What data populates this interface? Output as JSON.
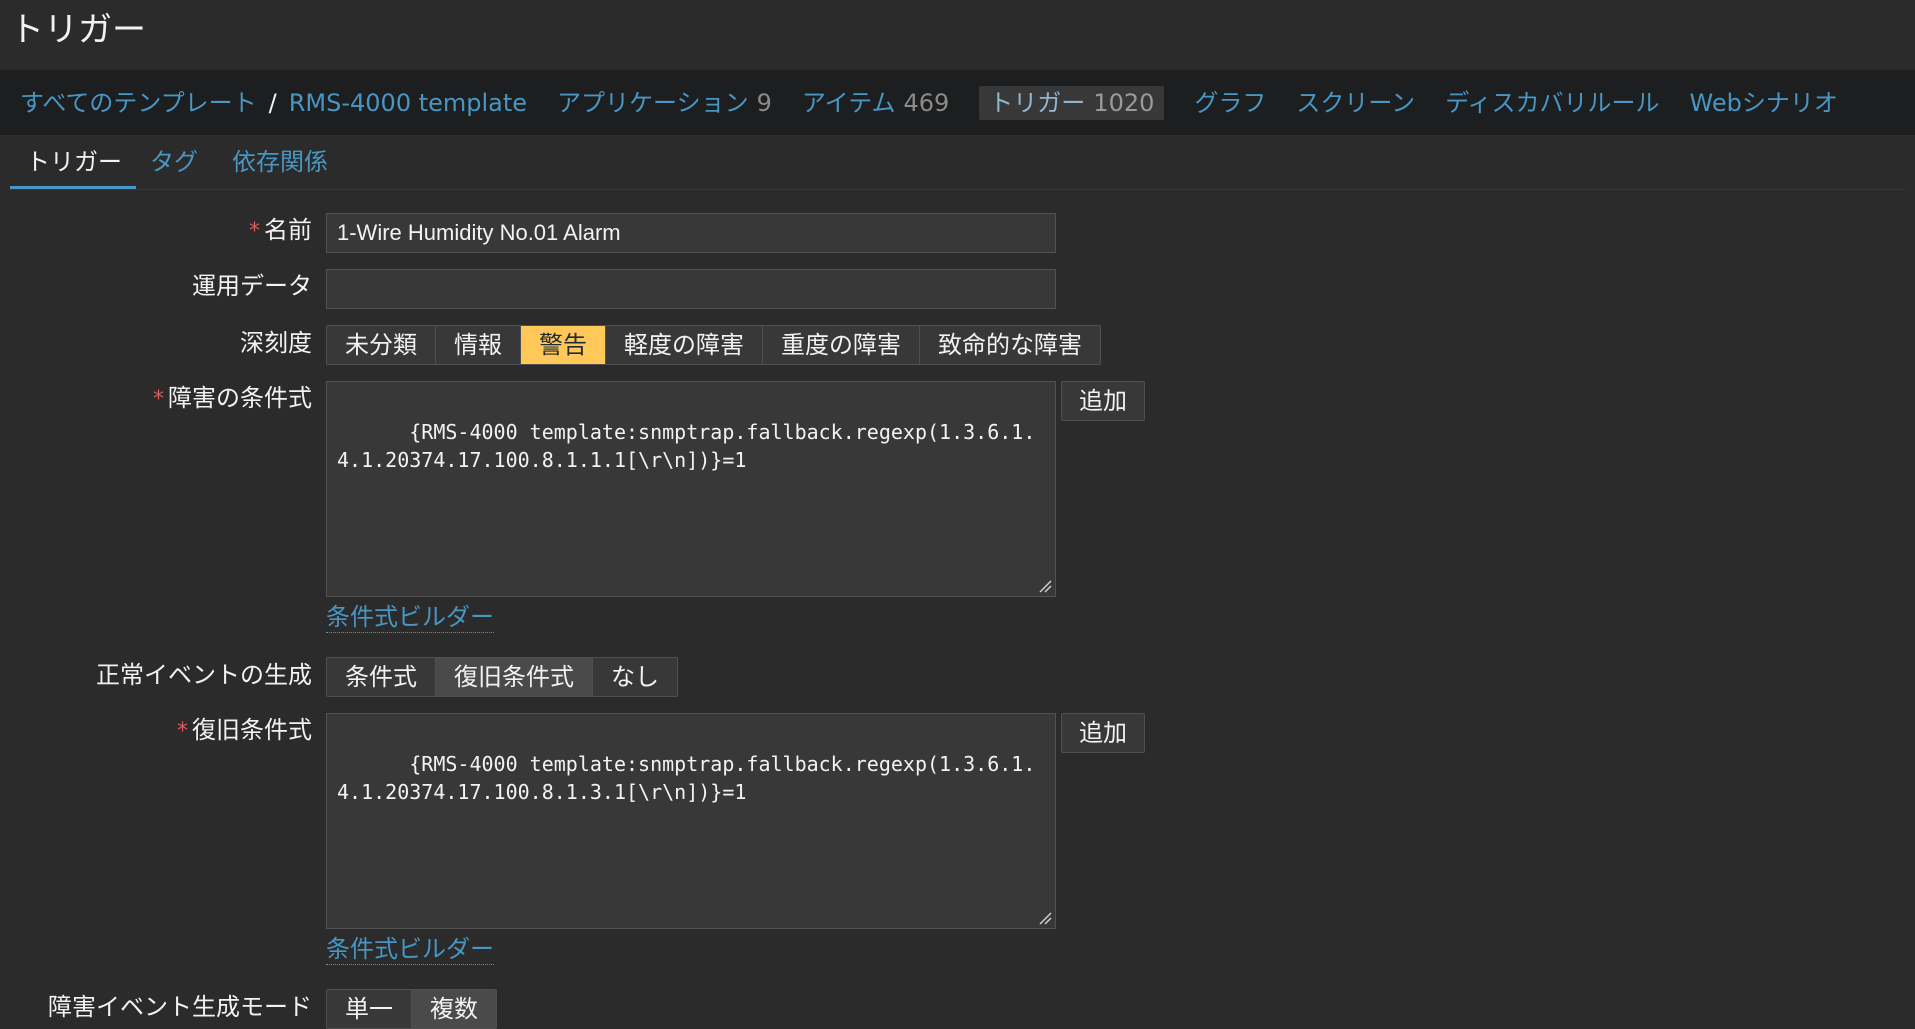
{
  "page": {
    "title": "トリガー"
  },
  "breadcrumb": {
    "all_templates": "すべてのテンプレート",
    "separator": "/",
    "template": "RMS-4000 template"
  },
  "nav": {
    "applications": {
      "label": "アプリケーション",
      "count": "9"
    },
    "items": {
      "label": "アイテム",
      "count": "469"
    },
    "triggers": {
      "label": "トリガー",
      "count": "1020"
    },
    "graphs": "グラフ",
    "screens": "スクリーン",
    "discovery": "ディスカバリルール",
    "web": "Webシナリオ"
  },
  "tabs": {
    "trigger": "トリガー",
    "tags": "タグ",
    "dependencies": "依存関係"
  },
  "form": {
    "required_mark": "*",
    "name_label": "名前",
    "name_value": "1-Wire Humidity No.01 Alarm",
    "opdata_label": "運用データ",
    "opdata_value": "",
    "severity_label": "深刻度",
    "severity_options": [
      "未分類",
      "情報",
      "警告",
      "軽度の障害",
      "重度の障害",
      "致命的な障害"
    ],
    "severity_selected": "警告",
    "problem_expr_label": "障害の条件式",
    "problem_expr_value": "{RMS-4000 template:snmptrap.fallback.regexp(1.3.6.1.4.1.20374.17.100.8.1.1.1[\\r\\n])}=1",
    "add_label": "追加",
    "expr_builder_label": "条件式ビルダー",
    "ok_event_label": "正常イベントの生成",
    "ok_event_options": [
      "条件式",
      "復旧条件式",
      "なし"
    ],
    "ok_event_selected": "復旧条件式",
    "recovery_expr_label": "復旧条件式",
    "recovery_expr_value": "{RMS-4000 template:snmptrap.fallback.regexp(1.3.6.1.4.1.20374.17.100.8.1.3.1[\\r\\n])}=1",
    "problem_mode_label": "障害イベント生成モード",
    "problem_mode_options": [
      "単一",
      "複数"
    ],
    "problem_mode_selected": "複数"
  },
  "colors": {
    "background": "#2b2b2b",
    "navbar": "#1d1e1f",
    "link": "#4796c4",
    "warning": "#ffc859",
    "required": "#e45959"
  }
}
